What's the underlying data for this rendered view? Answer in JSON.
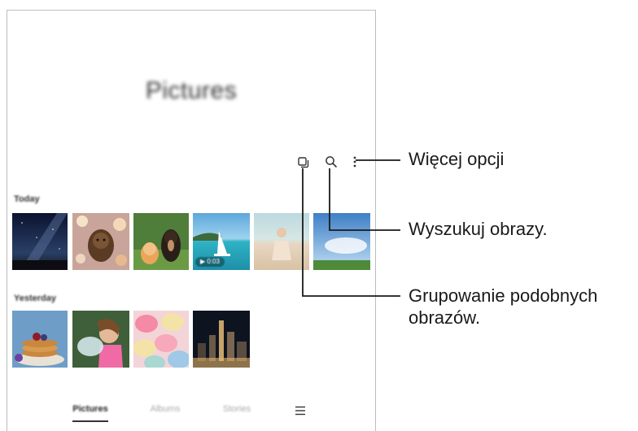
{
  "screen": {
    "title": "Pictures",
    "toolbar": {
      "group_icon": "group-similar-icon",
      "search_icon": "search-icon",
      "more_icon": "more-options-icon"
    },
    "sections": [
      {
        "label": "Today",
        "thumbnails": [
          "milky-way-night",
          "dog-festive-lights",
          "cat-and-dog",
          "sailboat-lagoon",
          "girl-on-beach",
          "sky-meadow"
        ]
      },
      {
        "label": "Yesterday",
        "thumbnails": [
          "pancakes",
          "girl-splashing-water",
          "macarons",
          "city-night"
        ]
      }
    ],
    "video_badge": "0:03",
    "bottom_nav": {
      "tabs": [
        "Pictures",
        "Albums",
        "Stories"
      ],
      "active_tab": "Pictures",
      "menu_icon": "hamburger-menu-icon"
    }
  },
  "callouts": {
    "more_options": "Więcej opcji",
    "search": "Wyszukuj obrazy.",
    "group_line1": "Grupowanie podobnych",
    "group_line2": "obrazów."
  },
  "colors": {
    "frame_border": "#bdbdbd",
    "leader_line": "#1a1a1a",
    "text_primary": "#1a1a1a"
  }
}
